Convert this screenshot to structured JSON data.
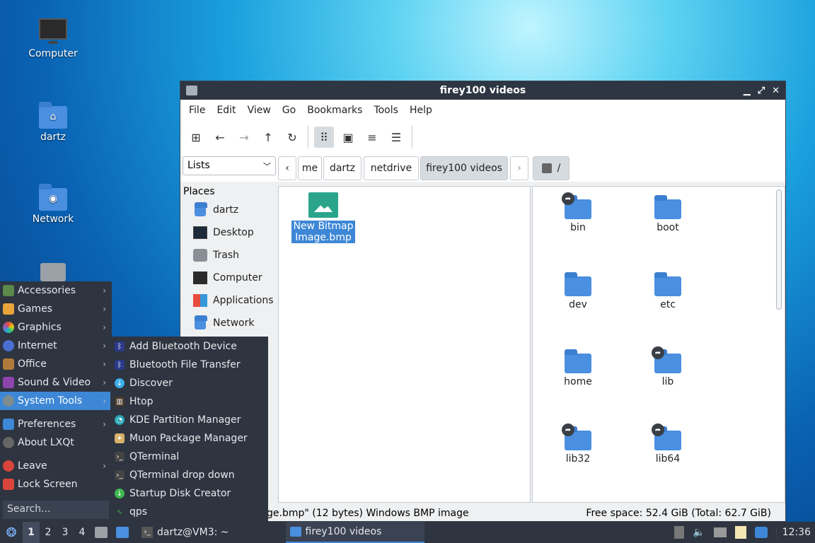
{
  "desktop": {
    "icons": [
      {
        "label": "Computer",
        "icon": "computer-icon"
      },
      {
        "label": "dartz",
        "icon": "home-folder-icon"
      },
      {
        "label": "Network",
        "icon": "network-folder-icon"
      },
      {
        "label": "",
        "icon": "trash-icon"
      }
    ]
  },
  "window": {
    "title": "firey100 videos",
    "controls": {
      "minimize": "▁",
      "maximize": "⤢",
      "close": "✕"
    },
    "menu": [
      "File",
      "Edit",
      "View",
      "Go",
      "Bookmarks",
      "Tools",
      "Help"
    ],
    "view_mode": "Lists",
    "breadcrumbs": [
      "me",
      "dartz",
      "netdrive",
      "firey100 videos"
    ],
    "root_crumb": "/",
    "places_header": "Places",
    "places": [
      "dartz",
      "Desktop",
      "Trash",
      "Computer",
      "Applications",
      "Network"
    ],
    "left_pane_files": [
      {
        "name": "New Bitmap Image.bmp",
        "selected": true
      }
    ],
    "right_pane_files": [
      {
        "name": "bin",
        "link": true
      },
      {
        "name": "boot",
        "link": false
      },
      {
        "name": "dev",
        "link": false
      },
      {
        "name": "etc",
        "link": false
      },
      {
        "name": "home",
        "link": false
      },
      {
        "name": "lib",
        "link": true
      },
      {
        "name": "lib32",
        "link": true
      },
      {
        "name": "lib64",
        "link": true
      }
    ],
    "status_left": "ge.bmp\" (12 bytes) Windows BMP image",
    "status_right": "Free space: 52.4 GiB (Total: 62.7 GiB)"
  },
  "app_menu": {
    "items": [
      "Accessories",
      "Games",
      "Graphics",
      "Internet",
      "Office",
      "Sound & Video",
      "System Tools",
      "Preferences",
      "About LXQt",
      "Leave",
      "Lock Screen"
    ],
    "active": "System Tools",
    "search_placeholder": "Search..."
  },
  "submenu": {
    "items": [
      "Add Bluetooth Device",
      "Bluetooth File Transfer",
      "Discover",
      "Htop",
      "KDE Partition Manager",
      "Muon Package Manager",
      "QTerminal",
      "QTerminal drop down",
      "Startup Disk Creator",
      "qps"
    ]
  },
  "taskbar": {
    "workspaces": [
      "1",
      "2",
      "3",
      "4"
    ],
    "terminal_task": "dartz@VM3: ~",
    "filemanager_task": "firey100 videos",
    "clock": "12:36"
  },
  "colors": {
    "accent": "#3d87d6",
    "panel": "#2e3440",
    "titlebar": "#2d3642",
    "folder": "#4a8fe0"
  }
}
